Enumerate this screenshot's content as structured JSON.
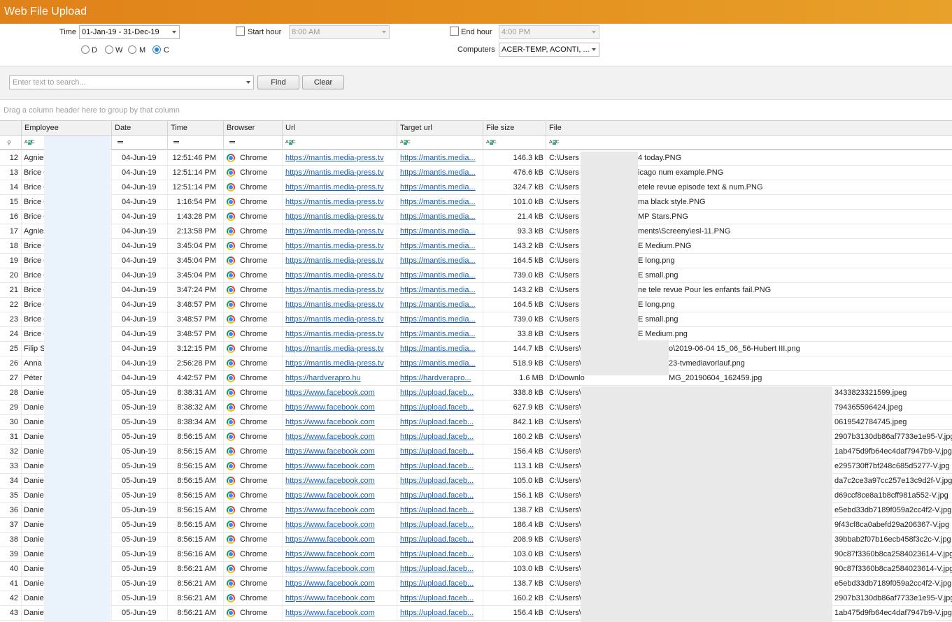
{
  "title": "Web File Upload",
  "filters": {
    "time_label": "Time",
    "time_value": "01-Jan-19 - 31-Dec-19",
    "start_hour_label": "Start hour",
    "start_hour_value": "8:00 AM",
    "end_hour_label": "End hour",
    "end_hour_value": "4:00 PM",
    "computers_label": "Computers",
    "computers_value": "ACER-TEMP, ACONTI, ...",
    "period_options": [
      "D",
      "W",
      "M",
      "C"
    ],
    "period_selected": "C"
  },
  "search": {
    "placeholder": "Enter text to search...",
    "find_label": "Find",
    "clear_label": "Clear"
  },
  "group_hint": "Drag a column header here to group by that column",
  "columns": [
    "Employee",
    "Date",
    "Time",
    "Browser",
    "Url",
    "Target url",
    "File size",
    "File"
  ],
  "rows": [
    {
      "n": "12",
      "emp": "Agnies",
      "date": "04-Jun-19",
      "time": "12:51:46 PM",
      "br": "Chrome",
      "url": "https://mantis.media-press.tv",
      "turl": "https://mantis.media...",
      "size": "146.3 kB",
      "file": "C:\\Users",
      "file_tail": "4 today.PNG"
    },
    {
      "n": "13",
      "emp": "Brice C",
      "date": "04-Jun-19",
      "time": "12:51:14 PM",
      "br": "Chrome",
      "url": "https://mantis.media-press.tv",
      "turl": "https://mantis.media...",
      "size": "476.6 kB",
      "file": "C:\\Users",
      "file_tail": "icago num example.PNG"
    },
    {
      "n": "14",
      "emp": "Brice C",
      "date": "04-Jun-19",
      "time": "12:51:14 PM",
      "br": "Chrome",
      "url": "https://mantis.media-press.tv",
      "turl": "https://mantis.media...",
      "size": "324.7 kB",
      "file": "C:\\Users",
      "file_tail": "etele revue episode text & num.PNG"
    },
    {
      "n": "15",
      "emp": "Brice C",
      "date": "04-Jun-19",
      "time": "1:16:54 PM",
      "br": "Chrome",
      "url": "https://mantis.media-press.tv",
      "turl": "https://mantis.media...",
      "size": "101.0 kB",
      "file": "C:\\Users",
      "file_tail": "ma black style.PNG"
    },
    {
      "n": "16",
      "emp": "Brice C",
      "date": "04-Jun-19",
      "time": "1:43:28 PM",
      "br": "Chrome",
      "url": "https://mantis.media-press.tv",
      "turl": "https://mantis.media...",
      "size": "21.4 kB",
      "file": "C:\\Users",
      "file_tail": "MP Stars.PNG"
    },
    {
      "n": "17",
      "emp": "Agnies",
      "date": "04-Jun-19",
      "time": "2:13:58 PM",
      "br": "Chrome",
      "url": "https://mantis.media-press.tv",
      "turl": "https://mantis.media...",
      "size": "93.3 kB",
      "file": "C:\\Users",
      "file_tail": "ments\\Screeny\\esl-11.PNG"
    },
    {
      "n": "18",
      "emp": "Brice C",
      "date": "04-Jun-19",
      "time": "3:45:04 PM",
      "br": "Chrome",
      "url": "https://mantis.media-press.tv",
      "turl": "https://mantis.media...",
      "size": "143.2 kB",
      "file": "C:\\Users",
      "file_tail": "E Medium.PNG"
    },
    {
      "n": "19",
      "emp": "Brice C",
      "date": "04-Jun-19",
      "time": "3:45:04 PM",
      "br": "Chrome",
      "url": "https://mantis.media-press.tv",
      "turl": "https://mantis.media...",
      "size": "164.5 kB",
      "file": "C:\\Users",
      "file_tail": "E long.png"
    },
    {
      "n": "20",
      "emp": "Brice C",
      "date": "04-Jun-19",
      "time": "3:45:04 PM",
      "br": "Chrome",
      "url": "https://mantis.media-press.tv",
      "turl": "https://mantis.media...",
      "size": "739.0 kB",
      "file": "C:\\Users",
      "file_tail": "E small.png"
    },
    {
      "n": "21",
      "emp": "Brice C",
      "date": "04-Jun-19",
      "time": "3:47:24 PM",
      "br": "Chrome",
      "url": "https://mantis.media-press.tv",
      "turl": "https://mantis.media...",
      "size": "143.2 kB",
      "file": "C:\\Users",
      "file_tail": "ne tele revue Pour les enfants fail.PNG"
    },
    {
      "n": "22",
      "emp": "Brice C",
      "date": "04-Jun-19",
      "time": "3:48:57 PM",
      "br": "Chrome",
      "url": "https://mantis.media-press.tv",
      "turl": "https://mantis.media...",
      "size": "164.5 kB",
      "file": "C:\\Users",
      "file_tail": "E long.png"
    },
    {
      "n": "23",
      "emp": "Brice C",
      "date": "04-Jun-19",
      "time": "3:48:57 PM",
      "br": "Chrome",
      "url": "https://mantis.media-press.tv",
      "turl": "https://mantis.media...",
      "size": "739.0 kB",
      "file": "C:\\Users",
      "file_tail": "E small.png"
    },
    {
      "n": "24",
      "emp": "Brice C",
      "date": "04-Jun-19",
      "time": "3:48:57 PM",
      "br": "Chrome",
      "url": "https://mantis.media-press.tv",
      "turl": "https://mantis.media...",
      "size": "33.8 kB",
      "file": "C:\\Users",
      "file_tail": "E Medium.png"
    },
    {
      "n": "25",
      "emp": "Filip Sl",
      "date": "04-Jun-19",
      "time": "3:12:15 PM",
      "br": "Chrome",
      "url": "https://mantis.media-press.tv",
      "turl": "https://mantis.media...",
      "size": "144.7 kB",
      "file": "C:\\Users\\",
      "file_tail": "o\\2019-06-04 15_06_56-Hubert III.png"
    },
    {
      "n": "26",
      "emp": "Anna",
      "date": "04-Jun-19",
      "time": "2:56:28 PM",
      "br": "Chrome",
      "url": "https://mantis.media-press.tv",
      "turl": "https://mantis.media...",
      "size": "518.9 kB",
      "file": "C:\\Users\\",
      "file_tail": "23-tvmediavorlauf.png"
    },
    {
      "n": "27",
      "emp": "Péter",
      "date": "04-Jun-19",
      "time": "4:42:57 PM",
      "br": "Chrome",
      "url": "https://hardverapro.hu",
      "turl": "https://hardverapro...",
      "size": "1.6 MB",
      "file": "D:\\Downlo",
      "file_tail": "MG_20190604_162459.jpg"
    },
    {
      "n": "28",
      "emp": "Daniel",
      "date": "05-Jun-19",
      "time": "8:38:31 AM",
      "br": "Chrome",
      "url": "https://www.facebook.com",
      "turl": "https://upload.faceb...",
      "size": "338.8 kB",
      "file": "C:\\Users\\",
      "file_tail": "3433823321599.jpeg"
    },
    {
      "n": "29",
      "emp": "Daniel",
      "date": "05-Jun-19",
      "time": "8:38:32 AM",
      "br": "Chrome",
      "url": "https://www.facebook.com",
      "turl": "https://upload.faceb...",
      "size": "627.9 kB",
      "file": "C:\\Users\\",
      "file_tail": "794365596424.jpeg"
    },
    {
      "n": "30",
      "emp": "Daniel",
      "date": "05-Jun-19",
      "time": "8:38:34 AM",
      "br": "Chrome",
      "url": "https://www.facebook.com",
      "turl": "https://upload.faceb...",
      "size": "842.1 kB",
      "file": "C:\\Users\\",
      "file_tail": "0619542784745.jpeg"
    },
    {
      "n": "31",
      "emp": "Daniel",
      "date": "05-Jun-19",
      "time": "8:56:15 AM",
      "br": "Chrome",
      "url": "https://www.facebook.com",
      "turl": "https://upload.faceb...",
      "size": "160.2 kB",
      "file": "C:\\Users\\",
      "file_tail": "2907b3130db86af7733e1e95-V.jpg"
    },
    {
      "n": "32",
      "emp": "Daniel",
      "date": "05-Jun-19",
      "time": "8:56:15 AM",
      "br": "Chrome",
      "url": "https://www.facebook.com",
      "turl": "https://upload.faceb...",
      "size": "156.4 kB",
      "file": "C:\\Users\\",
      "file_tail": "1ab475d9fb64ec4daf7947b9-V.jpg"
    },
    {
      "n": "33",
      "emp": "Daniel",
      "date": "05-Jun-19",
      "time": "8:56:15 AM",
      "br": "Chrome",
      "url": "https://www.facebook.com",
      "turl": "https://upload.faceb...",
      "size": "113.1 kB",
      "file": "C:\\Users\\",
      "file_tail": "e295730ff7bf248c685d5277-V.jpg"
    },
    {
      "n": "34",
      "emp": "Daniel",
      "date": "05-Jun-19",
      "time": "8:56:15 AM",
      "br": "Chrome",
      "url": "https://www.facebook.com",
      "turl": "https://upload.faceb...",
      "size": "105.0 kB",
      "file": "C:\\Users\\",
      "file_tail": "da7c2ce3a97cc257e13c9d2f-V.jpg"
    },
    {
      "n": "35",
      "emp": "Daniel",
      "date": "05-Jun-19",
      "time": "8:56:15 AM",
      "br": "Chrome",
      "url": "https://www.facebook.com",
      "turl": "https://upload.faceb...",
      "size": "156.1 kB",
      "file": "C:\\Users\\",
      "file_tail": "d69ccf8ce8a1b8cff981a552-V.jpg"
    },
    {
      "n": "36",
      "emp": "Daniel",
      "date": "05-Jun-19",
      "time": "8:56:15 AM",
      "br": "Chrome",
      "url": "https://www.facebook.com",
      "turl": "https://upload.faceb...",
      "size": "138.7 kB",
      "file": "C:\\Users\\",
      "file_tail": "e5ebd33db7189f059a2cc4f2-V.jpg"
    },
    {
      "n": "37",
      "emp": "Daniel",
      "date": "05-Jun-19",
      "time": "8:56:15 AM",
      "br": "Chrome",
      "url": "https://www.facebook.com",
      "turl": "https://upload.faceb...",
      "size": "186.4 kB",
      "file": "C:\\Users\\",
      "file_tail": "9f43cf8ca0abefd29a206367-V.jpg"
    },
    {
      "n": "38",
      "emp": "Daniel",
      "date": "05-Jun-19",
      "time": "8:56:15 AM",
      "br": "Chrome",
      "url": "https://www.facebook.com",
      "turl": "https://upload.faceb...",
      "size": "208.9 kB",
      "file": "C:\\Users\\",
      "file_tail": "39bbab2f07b16ecb458f3c2c-V.jpg"
    },
    {
      "n": "39",
      "emp": "Daniel",
      "date": "05-Jun-19",
      "time": "8:56:16 AM",
      "br": "Chrome",
      "url": "https://www.facebook.com",
      "turl": "https://upload.faceb...",
      "size": "103.0 kB",
      "file": "C:\\Users\\",
      "file_tail": "90c87f3360b8ca2584023614-V.jpg"
    },
    {
      "n": "40",
      "emp": "Daniel",
      "date": "05-Jun-19",
      "time": "8:56:21 AM",
      "br": "Chrome",
      "url": "https://www.facebook.com",
      "turl": "https://upload.faceb...",
      "size": "103.0 kB",
      "file": "C:\\Users\\",
      "file_tail": "90c87f3360b8ca2584023614-V.jpg"
    },
    {
      "n": "41",
      "emp": "Daniel",
      "date": "05-Jun-19",
      "time": "8:56:21 AM",
      "br": "Chrome",
      "url": "https://www.facebook.com",
      "turl": "https://upload.faceb...",
      "size": "138.7 kB",
      "file": "C:\\Users\\",
      "file_tail": "e5ebd33db7189f059a2cc4f2-V.jpg"
    },
    {
      "n": "42",
      "emp": "Daniel",
      "date": "05-Jun-19",
      "time": "8:56:21 AM",
      "br": "Chrome",
      "url": "https://www.facebook.com",
      "turl": "https://upload.faceb...",
      "size": "160.2 kB",
      "file": "C:\\Users\\",
      "file_tail": "2907b3130db86af7733e1e95-V.jpg"
    },
    {
      "n": "43",
      "emp": "Daniel",
      "date": "05-Jun-19",
      "time": "8:56:21 AM",
      "br": "Chrome",
      "url": "https://www.facebook.com",
      "turl": "https://upload.faceb...",
      "size": "156.4 kB",
      "file": "C:\\Users\\",
      "file_tail": "1ab475d9fb64ec4daf7947b9-V.jpg"
    }
  ]
}
